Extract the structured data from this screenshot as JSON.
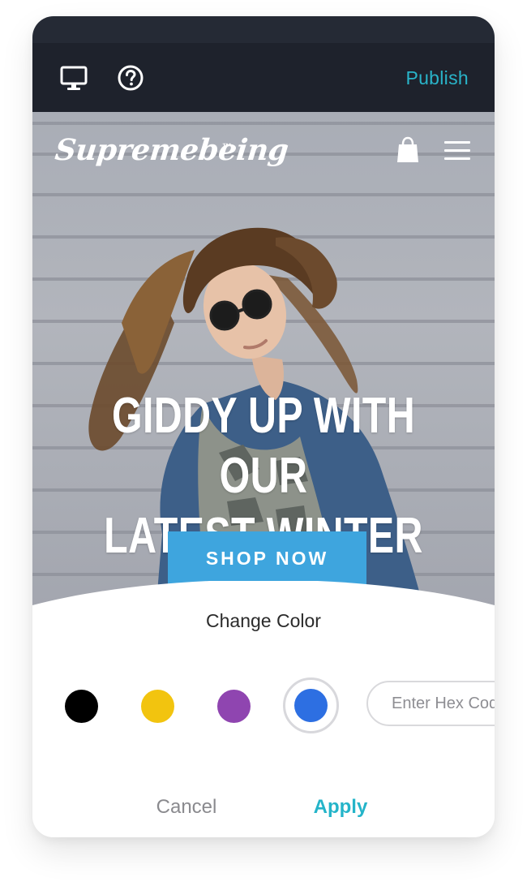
{
  "toolbar": {
    "publish_label": "Publish",
    "icons": [
      "desktop-preview-icon",
      "help-icon"
    ]
  },
  "hero": {
    "logo_text": "Supremebeing",
    "logo_tm": "™",
    "headline_line1": "GIDDY UP WITH OUR",
    "headline_line2": "LATEST WINTER STASH",
    "cta_label": "SHOP NOW",
    "cta_color": "#3ea5de",
    "icons": [
      "shopping-bag-icon",
      "hamburger-menu-icon"
    ]
  },
  "color_picker": {
    "title": "Change Color",
    "swatches": [
      {
        "name": "black",
        "color": "#000000",
        "selected": false
      },
      {
        "name": "yellow",
        "color": "#f2c40f",
        "selected": false
      },
      {
        "name": "purple",
        "color": "#8f45b0",
        "selected": false
      },
      {
        "name": "blue",
        "color": "#2d6fe2",
        "selected": true
      }
    ],
    "hex_placeholder": "Enter Hex Code",
    "hex_value": "",
    "cancel_label": "Cancel",
    "apply_label": "Apply",
    "accent_color": "#24b4c9"
  }
}
